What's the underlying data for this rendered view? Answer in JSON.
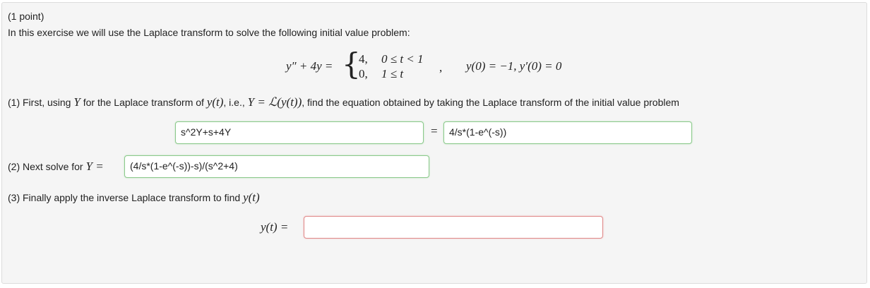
{
  "problem": {
    "points": "(1 point)",
    "intro": "In this exercise we will use the Laplace transform to solve the following initial value problem:",
    "equation": {
      "lhs": "y″ + 4y =",
      "case1_value": "4,",
      "case1_cond": "0 ≤ t < 1",
      "case2_value": "0,",
      "case2_cond": "1 ≤ t",
      "comma": ",",
      "initial": "y(0) = −1, y′(0) = 0"
    }
  },
  "part1": {
    "text_a": "(1) First, using",
    "Y": "Y",
    "text_b": "for the Laplace transform of",
    "yt": "y(t)",
    "text_c": ", i.e.,",
    "def": "Y = ℒ(y(t))",
    "text_d": ", find the equation obtained by taking the Laplace transform of the initial value problem",
    "left_answer": "s^2Y+s+4Y",
    "equals": "=",
    "right_answer": "4/s*(1-e^(-s))"
  },
  "part2": {
    "text": "(2) Next solve for",
    "Yeq": "Y =",
    "answer": "(4/s*(1-e^(-s))-s)/(s^2+4)"
  },
  "part3": {
    "text": "(3) Finally apply the inverse Laplace transform to find",
    "yt": "y(t)",
    "label": "y(t) =",
    "answer": ""
  }
}
